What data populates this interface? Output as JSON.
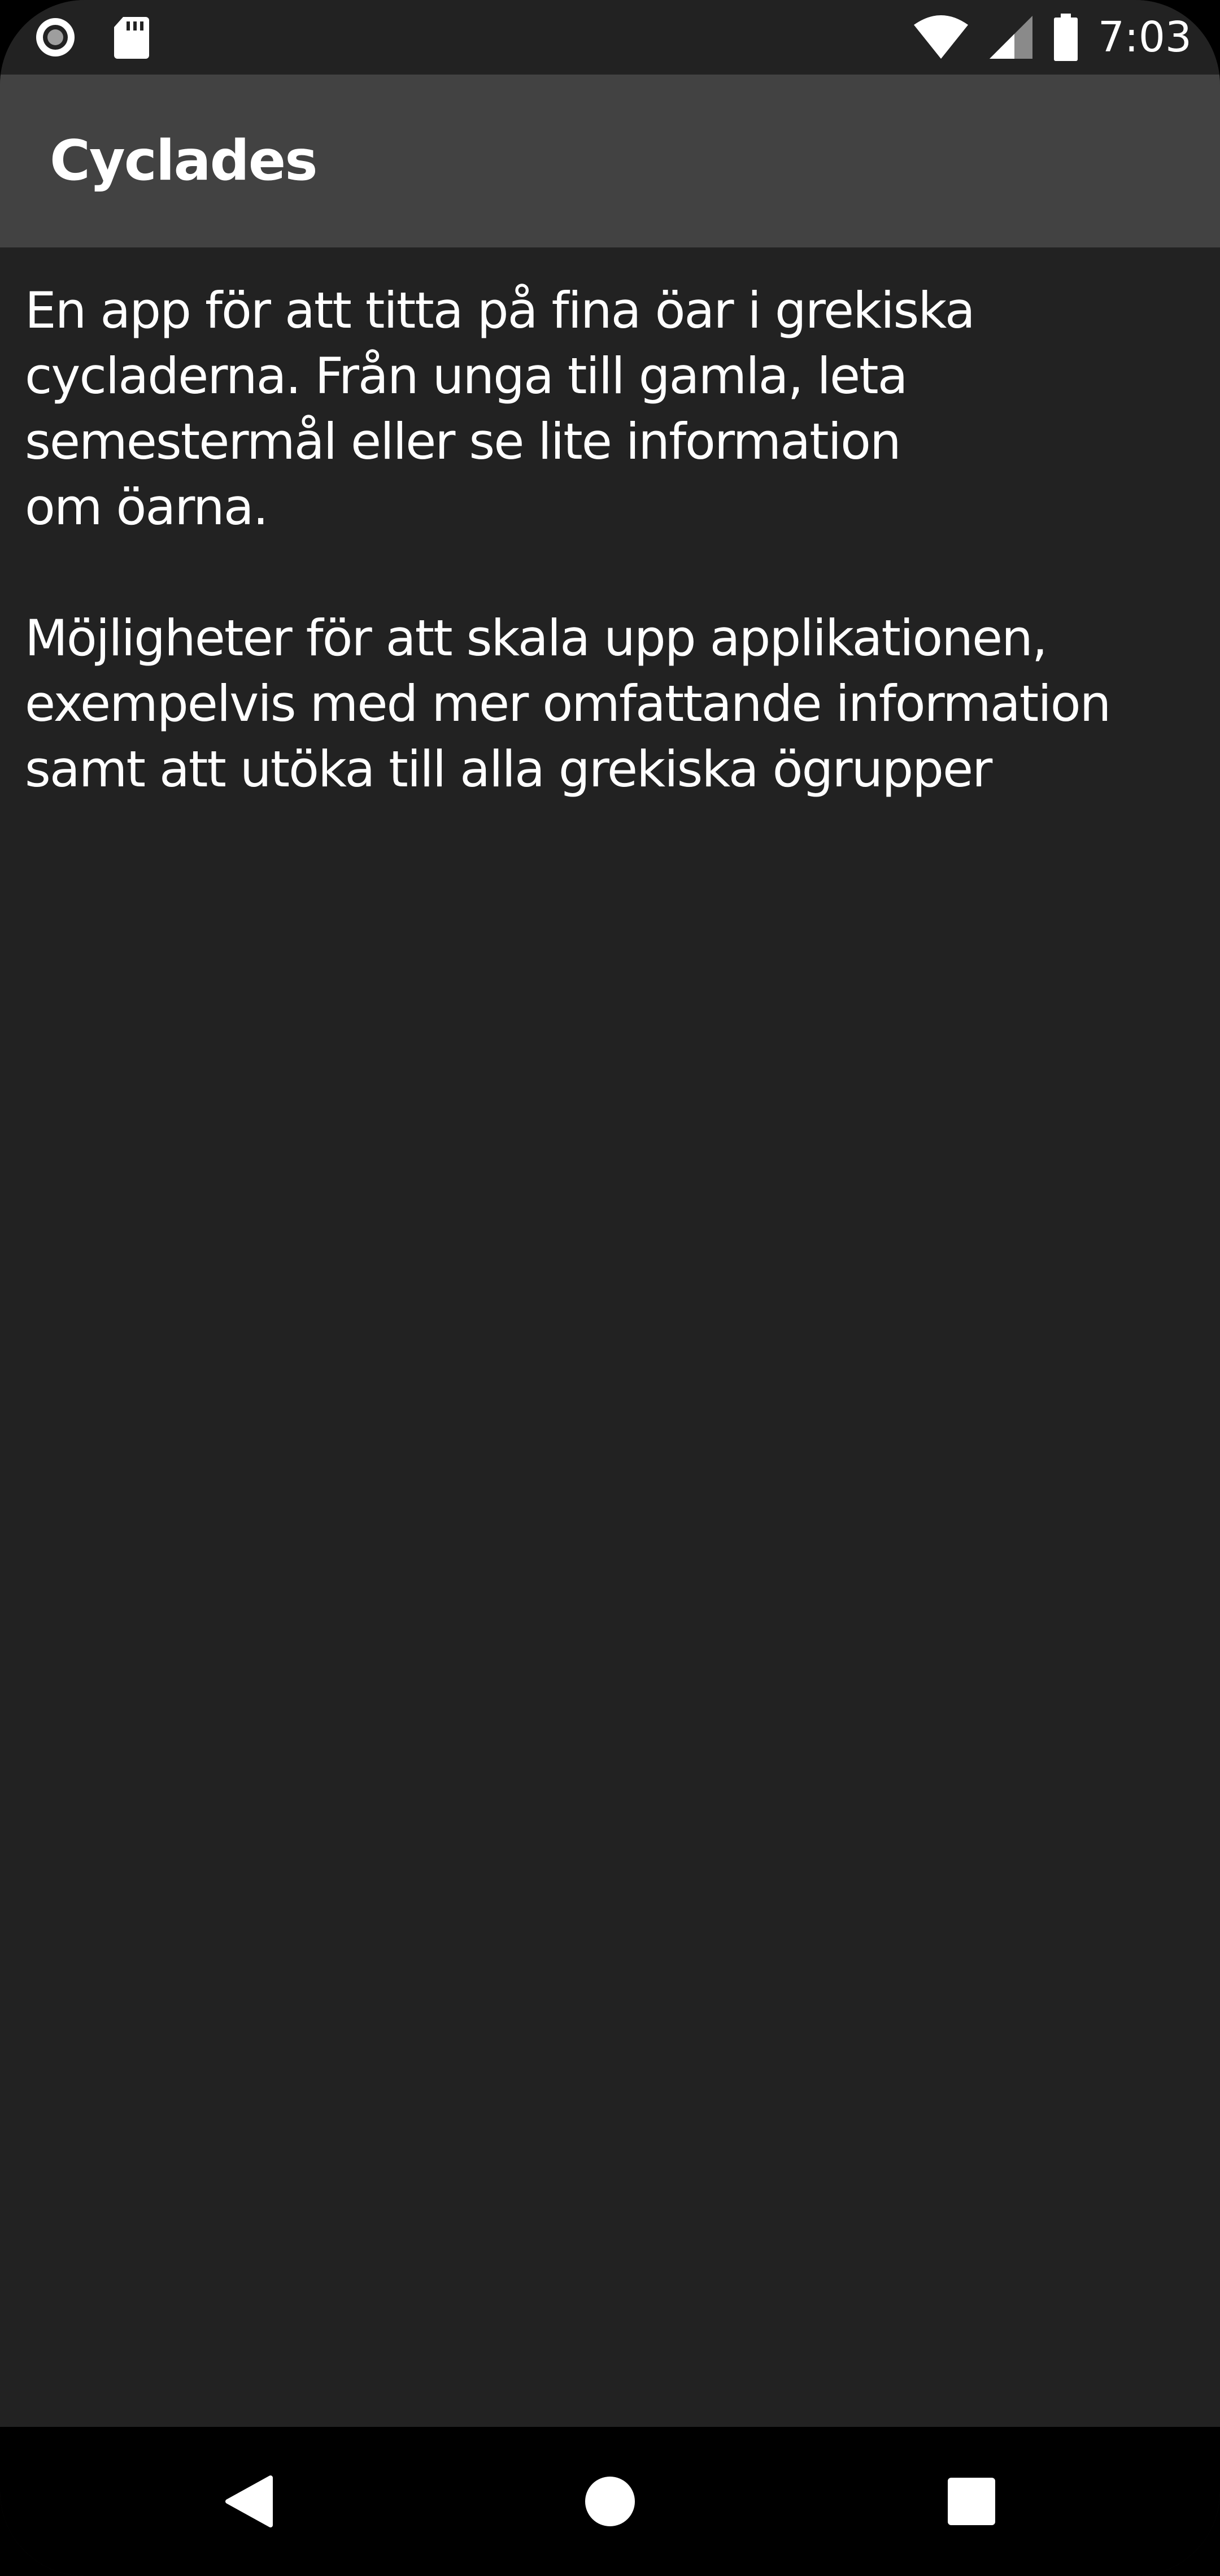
{
  "status_bar": {
    "time": "7:03",
    "left_icons": [
      "record-icon",
      "sd-card-icon"
    ],
    "right_icons": [
      "wifi-icon",
      "cell-signal-icon",
      "battery-icon"
    ]
  },
  "toolbar": {
    "title": "Cyclades"
  },
  "content": {
    "paragraphs": [
      "En app för att titta på fina öar i grekiska\ncycladerna. Från unga till gamla, leta\nsemestermål eller se lite information\nom öarna.",
      "Möjligheter för att skala upp applikationen,\nexempelvis med mer omfattande information\nsamt att utöka till alla grekiska ögrupper"
    ]
  },
  "navigation": {
    "buttons": [
      "back-icon",
      "home-icon",
      "recents-icon"
    ]
  },
  "colors": {
    "background": "#222222",
    "toolbar": "#424242",
    "nav_bar": "#000000",
    "text": "#ffffff"
  }
}
